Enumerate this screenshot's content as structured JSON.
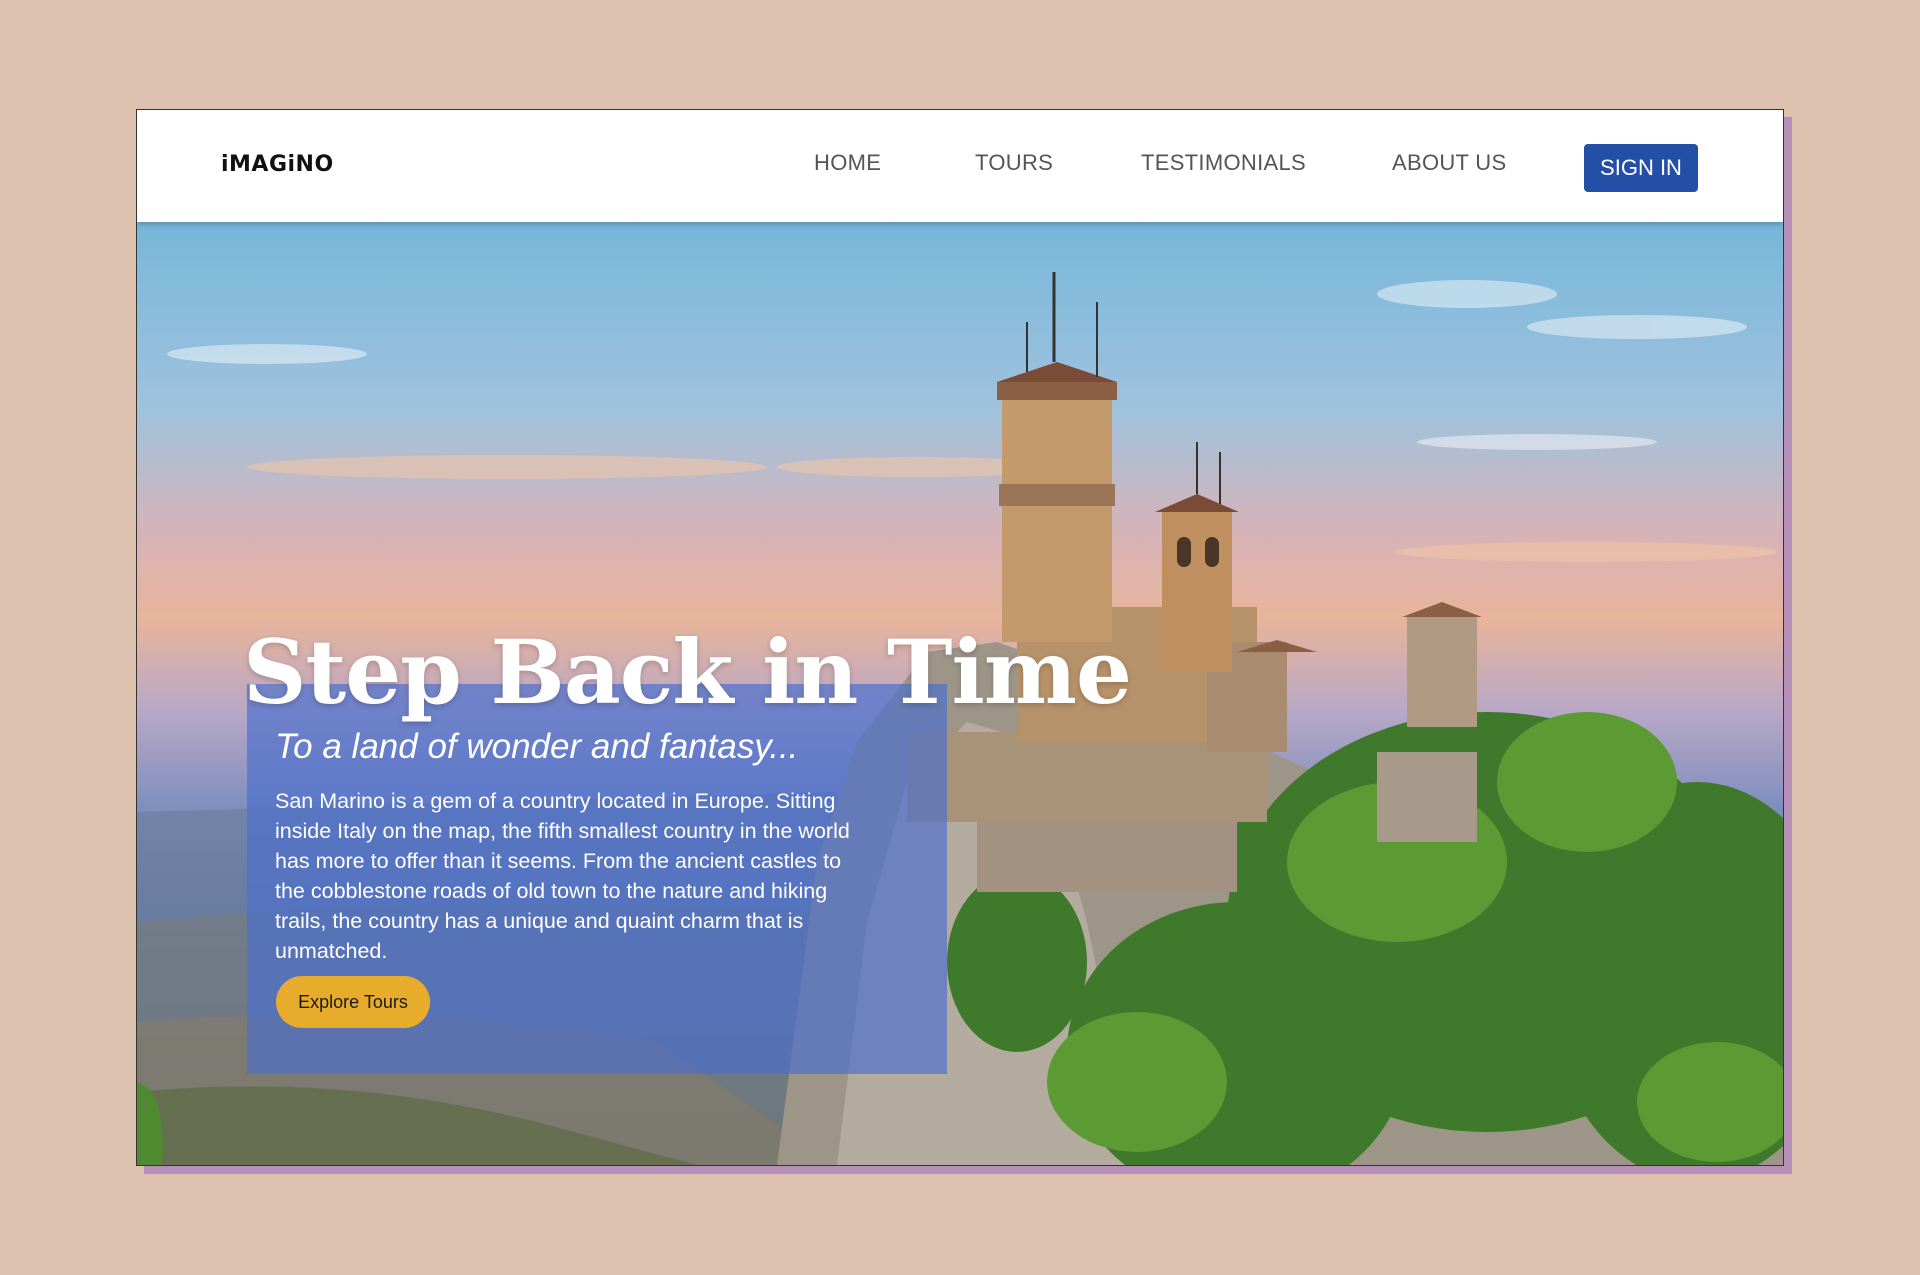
{
  "brand": {
    "logo_text": "iMAGiNO"
  },
  "nav": {
    "items": [
      {
        "label": "HOME"
      },
      {
        "label": "TOURS"
      },
      {
        "label": "TESTIMONIALS"
      },
      {
        "label": "ABOUT US"
      }
    ],
    "signin_label": "SIGN IN"
  },
  "hero": {
    "title": "Step Back in Time",
    "subtitle": "To a land of wonder and fantasy...",
    "body": "San Marino is a gem of a country located in Europe. Sitting inside Italy on the map, the fifth smallest country in the world has more to offer than it seems. From the ancient castles to the cobblestone roads of old town to the nature and hiking trails, the country has a unique and quaint charm that is unmatched.",
    "cta_label": "Explore Tours"
  },
  "colors": {
    "page_background": "#dbc1ae",
    "frame_shadow": "#b58fb7",
    "signin_button": "#2350a6",
    "cta_button": "#e8ac2c",
    "hero_overlay": "#4b6ecd",
    "nav_text": "#555555"
  }
}
